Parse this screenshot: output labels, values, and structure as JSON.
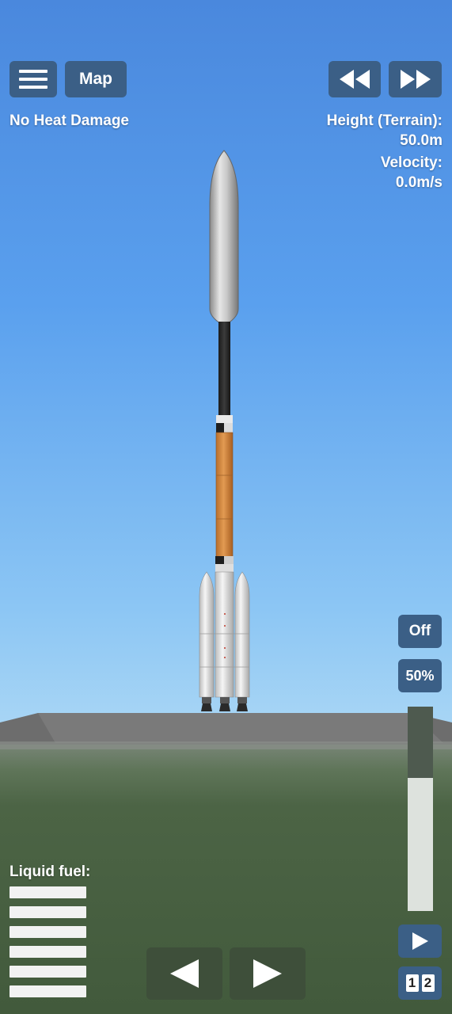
{
  "top_bar": {
    "menu_icon": "hamburger-menu-icon",
    "map_label": "Map",
    "rewind_icon": "rewind-icon",
    "fast_forward_icon": "fast-forward-icon"
  },
  "status": {
    "heat_text": "No Heat Damage",
    "height_label": "Height (Terrain):",
    "height_value": "50.0m",
    "velocity_label": "Velocity:",
    "velocity_value": "0.0m/s"
  },
  "controls": {
    "sas_label": "Off",
    "throttle_label": "50%",
    "throttle_level": 0.5,
    "stage_icon": "play-stage-icon",
    "rotate_left_icon": "triangle-left-icon",
    "rotate_right_icon": "triangle-right-icon",
    "view_labels": [
      "1",
      "2"
    ]
  },
  "fuel": {
    "label": "Liquid fuel:",
    "bars": 6
  },
  "colors": {
    "button_bg": "#3b5f86",
    "ground": "#475f3f",
    "launch_pad": "#707070",
    "fuel_tank": "#d98d46"
  }
}
